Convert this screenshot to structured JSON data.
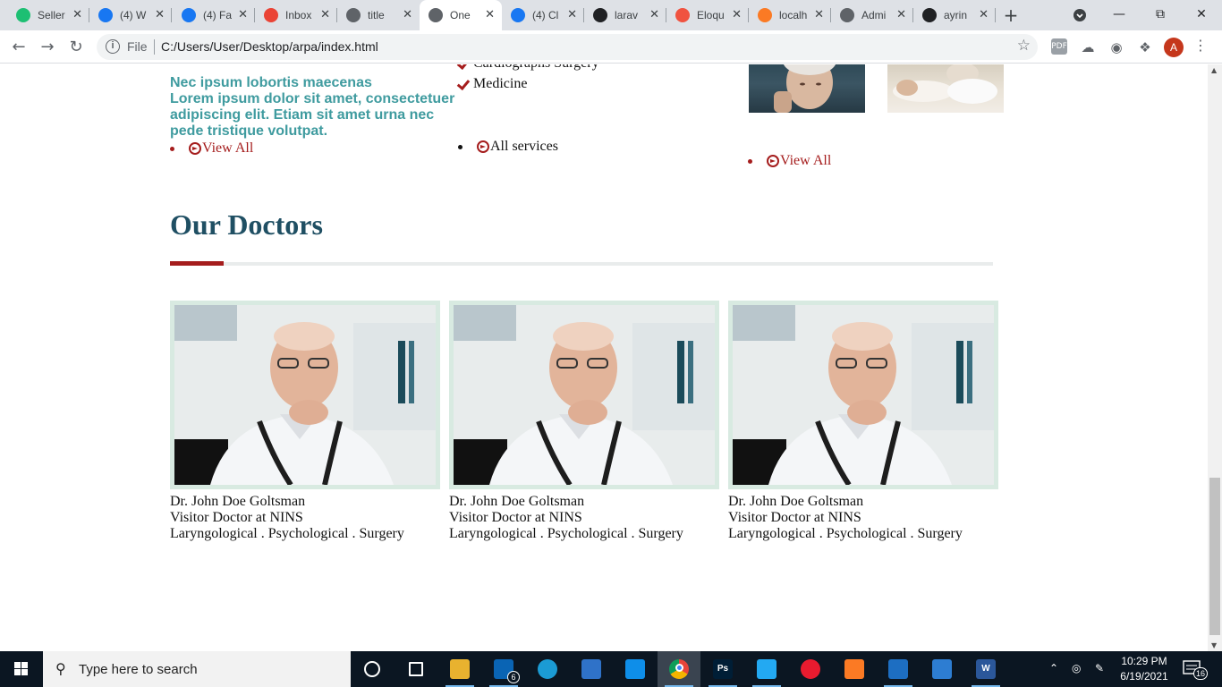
{
  "browser": {
    "tabs": [
      {
        "label": "Seller",
        "icon": "fiverr-icon",
        "color": "#1dbf73"
      },
      {
        "label": "(4) W",
        "icon": "facebook-icon",
        "color": "#1877f2"
      },
      {
        "label": "(4) Fa",
        "icon": "facebook-icon",
        "color": "#1877f2"
      },
      {
        "label": "Inbox",
        "icon": "gmail-icon",
        "color": "#ea4335"
      },
      {
        "label": "title",
        "icon": "globe-icon",
        "color": "#5f6368"
      },
      {
        "label": "One",
        "icon": "globe-icon",
        "color": "#5f6368"
      },
      {
        "label": "(4) Cl",
        "icon": "facebook-icon",
        "color": "#1877f2"
      },
      {
        "label": "larav",
        "icon": "github-icon",
        "color": "#202124"
      },
      {
        "label": "Eloqu",
        "icon": "laravel-icon",
        "color": "#f05340"
      },
      {
        "label": "localh",
        "icon": "xampp-icon",
        "color": "#fb7a24"
      },
      {
        "label": "Admi",
        "icon": "globe-icon",
        "color": "#5f6368"
      },
      {
        "label": "ayrin",
        "icon": "github-icon",
        "color": "#202124"
      }
    ],
    "active_tab": 5,
    "url_scheme": "File",
    "url": "C:/Users/User/Desktop/arpa/index.html",
    "profile_initial": "A"
  },
  "page": {
    "about": {
      "title": "Nec ipsum lobortis maecenas",
      "text": "Lorem ipsum dolor sit amet, consectetuer adipiscing elit. Etiam sit amet urna nec pede tristique volutpat.",
      "link": "View All"
    },
    "services": {
      "items": [
        "Cardiographs Surgery",
        "Medicine"
      ],
      "link": "All services"
    },
    "gallery": {
      "link": "View All"
    },
    "doctors_section": {
      "title": "Our Doctors",
      "accent_color": "#a51d1d",
      "title_color": "#1f4f63"
    },
    "doctors": [
      {
        "name": "Dr. John Doe Goltsman",
        "role": "Visitor Doctor at NINS",
        "specialties": "Laryngological . Psychological . Surgery"
      },
      {
        "name": "Dr. John Doe Goltsman",
        "role": "Visitor Doctor at NINS",
        "specialties": "Laryngological . Psychological . Surgery"
      },
      {
        "name": "Dr. John Doe Goltsman",
        "role": "Visitor Doctor at NINS",
        "specialties": "Laryngological . Psychological . Surgery"
      }
    ]
  },
  "taskbar": {
    "search_placeholder": "Type here to search",
    "mail_badge": "6",
    "time": "10:29 PM",
    "date": "6/19/2021",
    "notifications": "16",
    "apps": [
      {
        "name": "cortana-icon",
        "label": ""
      },
      {
        "name": "task-view-icon",
        "label": ""
      },
      {
        "name": "file-explorer-icon",
        "label": "",
        "color": "#e8b22f"
      },
      {
        "name": "mail-icon",
        "label": "",
        "color": "#0a64b4"
      },
      {
        "name": "edge-icon",
        "label": "",
        "color": "#1b9bd4"
      },
      {
        "name": "store-icon",
        "label": "",
        "color": "#2f72c8"
      },
      {
        "name": "teamviewer-icon",
        "label": "",
        "color": "#0e8ee9"
      },
      {
        "name": "chrome-icon",
        "label": "",
        "color": "#e8443a"
      },
      {
        "name": "photoshop-icon",
        "label": "Ps",
        "color": "#001e36"
      },
      {
        "name": "vscode-icon",
        "label": "",
        "color": "#23a9f2"
      },
      {
        "name": "opera-icon",
        "label": "",
        "color": "#e81b2f"
      },
      {
        "name": "xampp-icon",
        "label": "",
        "color": "#fb7a24"
      },
      {
        "name": "video-icon",
        "label": "",
        "color": "#1d6ec2"
      },
      {
        "name": "photos-icon",
        "label": "",
        "color": "#2d7dd2"
      },
      {
        "name": "word-icon",
        "label": "W",
        "color": "#2b579a"
      }
    ]
  }
}
